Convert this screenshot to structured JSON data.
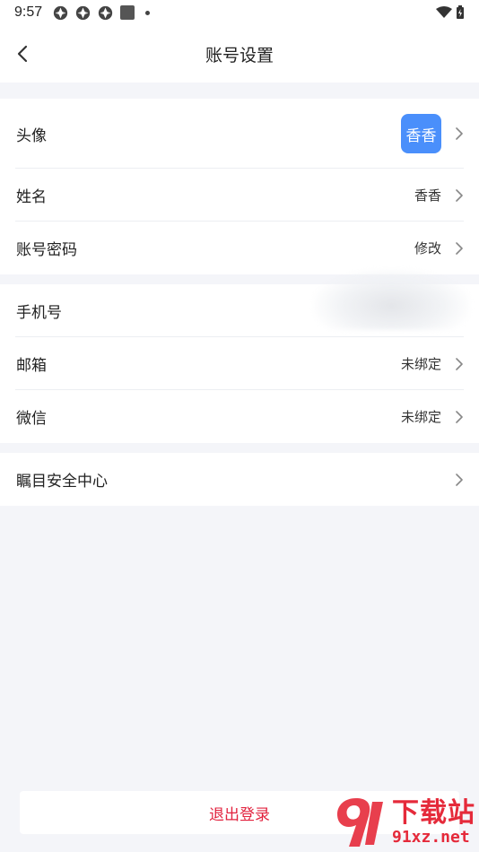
{
  "status_bar": {
    "time": "9:57"
  },
  "nav": {
    "title": "账号设置"
  },
  "group1": {
    "avatar": {
      "label": "头像",
      "avatar_text": "香香",
      "avatar_color": "#4a8ffb"
    },
    "name": {
      "label": "姓名",
      "value": "香香"
    },
    "password": {
      "label": "账号密码",
      "value": "修改"
    }
  },
  "group2": {
    "phone": {
      "label": "手机号"
    },
    "email": {
      "label": "邮箱",
      "value": "未绑定"
    },
    "wechat": {
      "label": "微信",
      "value": "未绑定"
    }
  },
  "group3": {
    "security": {
      "label": "瞩目安全中心"
    }
  },
  "logout": {
    "label": "退出登录",
    "color": "#e2233f"
  },
  "watermark": {
    "cn": "下载站",
    "url": "91xz.net"
  }
}
